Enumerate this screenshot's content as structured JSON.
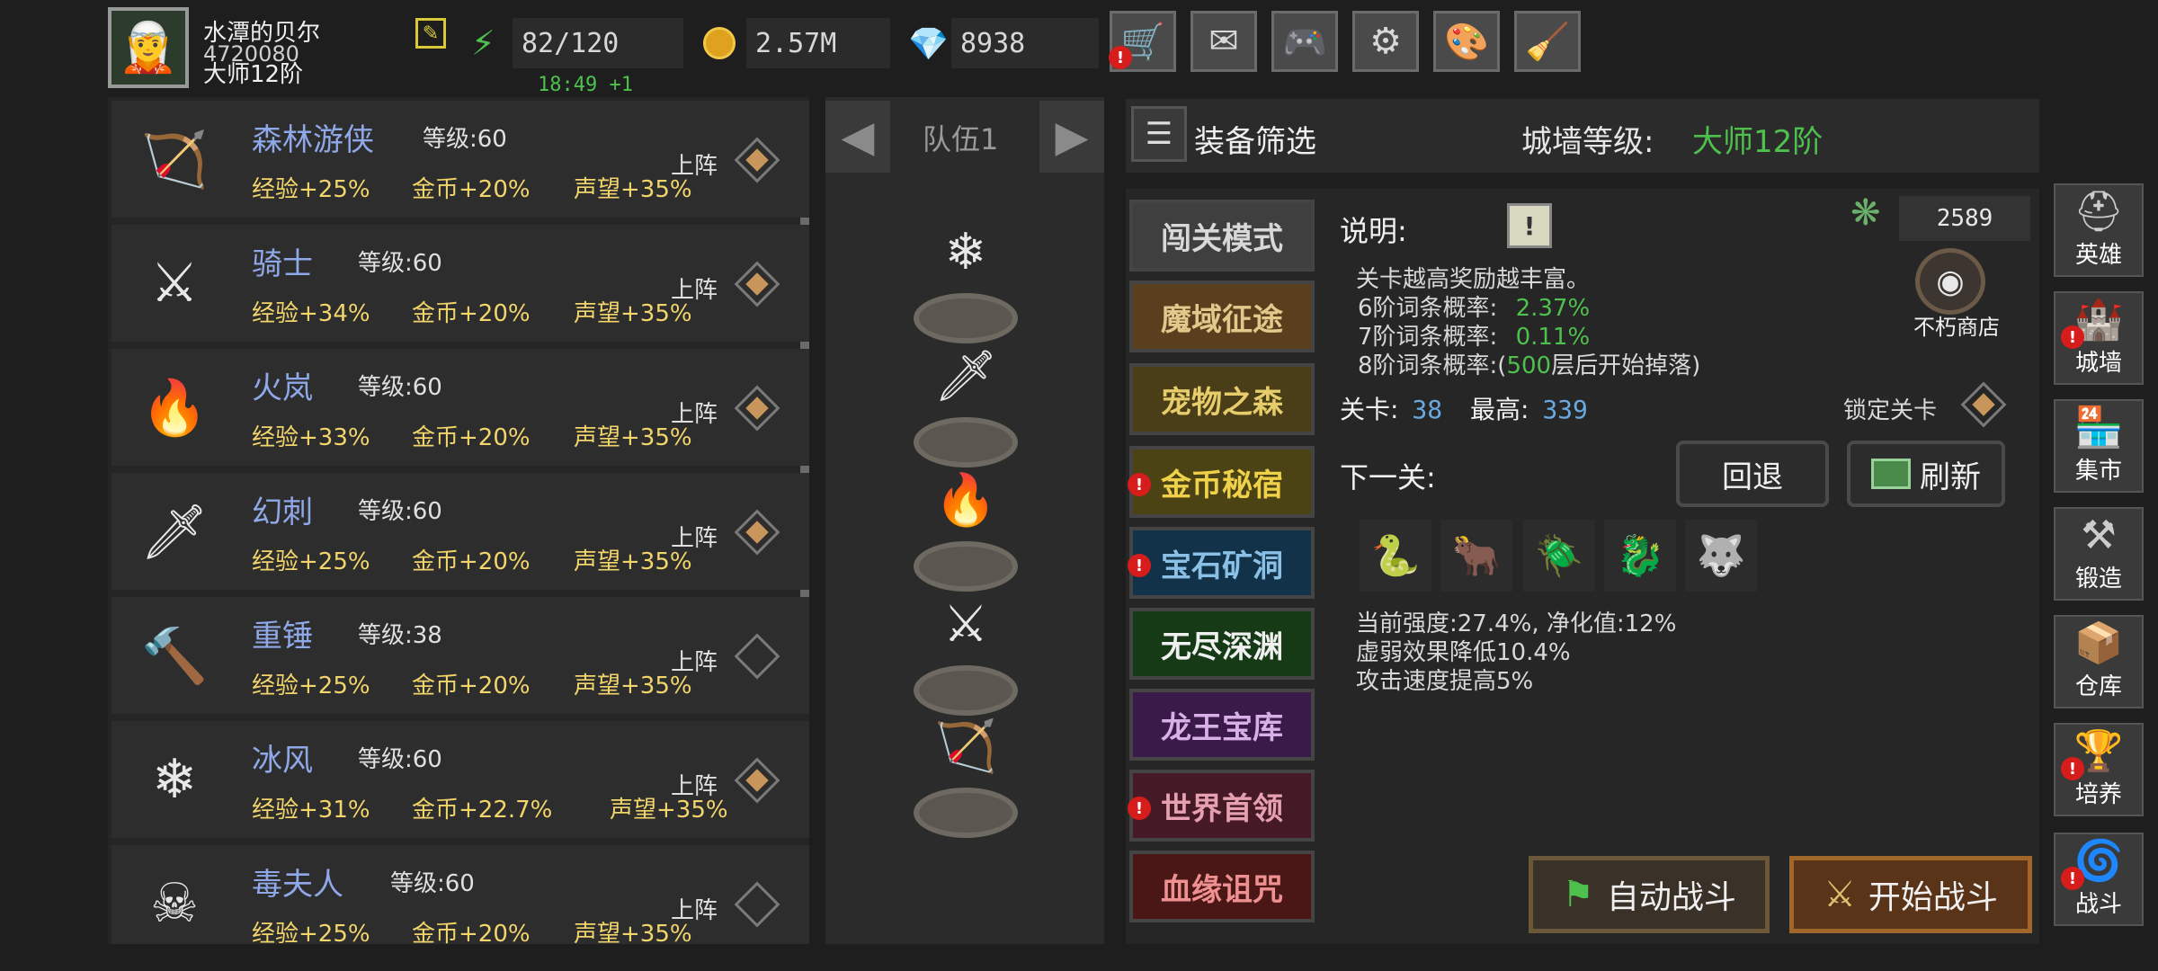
{
  "player": {
    "name": "水潭的贝尔",
    "id": "4720080",
    "rank": "大师12阶"
  },
  "stats": {
    "energy": "82/120",
    "energy_timer": "18:49 +1",
    "gold": "2.57M",
    "gems": "8938"
  },
  "top_icons": [
    "cart-icon",
    "mail-icon",
    "gamepad-icon",
    "gear-icon",
    "palette-icon",
    "broom-icon"
  ],
  "heroes": [
    {
      "name": "森林游侠",
      "level": "等级:60",
      "exp": "经验+25%",
      "gold": "金币+20%",
      "fame": "声望+35%",
      "deploy": "上阵",
      "active": true,
      "sprite": "🏹"
    },
    {
      "name": "骑士",
      "level": "等级:60",
      "exp": "经验+34%",
      "gold": "金币+20%",
      "fame": "声望+35%",
      "deploy": "上阵",
      "active": true,
      "sprite": "⚔"
    },
    {
      "name": "火岚",
      "level": "等级:60",
      "exp": "经验+33%",
      "gold": "金币+20%",
      "fame": "声望+35%",
      "deploy": "上阵",
      "active": true,
      "sprite": "🔥"
    },
    {
      "name": "幻刺",
      "level": "等级:60",
      "exp": "经验+25%",
      "gold": "金币+20%",
      "fame": "声望+35%",
      "deploy": "上阵",
      "active": true,
      "sprite": "🗡"
    },
    {
      "name": "重锤",
      "level": "等级:38",
      "exp": "经验+25%",
      "gold": "金币+20%",
      "fame": "声望+35%",
      "deploy": "上阵",
      "active": false,
      "sprite": "🔨"
    },
    {
      "name": "冰风",
      "level": "等级:60",
      "exp": "经验+31%",
      "gold": "金币+22.7%",
      "fame": "声望+35%",
      "deploy": "上阵",
      "active": true,
      "sprite": "❄"
    },
    {
      "name": "毒夫人",
      "level": "等级:60",
      "exp": "经验+25%",
      "gold": "金币+20%",
      "fame": "声望+35%",
      "deploy": "上阵",
      "active": false,
      "sprite": "☠"
    }
  ],
  "team": {
    "label": "队伍1",
    "members": [
      "❄",
      "🗡",
      "🔥",
      "⚔",
      "🏹"
    ]
  },
  "filter_label": "装备筛选",
  "wall": {
    "label": "城墙等级:",
    "value": "大师12阶"
  },
  "modes": [
    {
      "label": "闯关模式",
      "bg": "#3f3f3f",
      "fg": "#d8d8d8",
      "alert": false
    },
    {
      "label": "魔域征途",
      "bg": "#5a3f1f",
      "fg": "#e2c88a",
      "alert": false
    },
    {
      "label": "宠物之森",
      "bg": "#4a3e18",
      "fg": "#e6cc6a",
      "alert": false
    },
    {
      "label": "金币秘宿",
      "bg": "#4c4314",
      "fg": "#f0d24a",
      "alert": true
    },
    {
      "label": "宝石矿洞",
      "bg": "#12324a",
      "fg": "#8ac0e6",
      "alert": true
    },
    {
      "label": "无尽深渊",
      "bg": "#163a16",
      "fg": "#f0f0f0",
      "alert": false
    },
    {
      "label": "龙王宝库",
      "bg": "#3a1a48",
      "fg": "#d8b0e8",
      "alert": false
    },
    {
      "label": "世界首领",
      "bg": "#451a26",
      "fg": "#e6a0b0",
      "alert": true
    },
    {
      "label": "血缘诅咒",
      "bg": "#4a1616",
      "fg": "#ee9090",
      "alert": false
    }
  ],
  "info": {
    "title": "说明:",
    "line1": "关卡越高奖励越丰富。",
    "p6_label": "6阶词条概率:",
    "p6_value": "2.37%",
    "p7_label": "7阶词条概率:",
    "p7_value": "0.11%",
    "p8_label": "8阶词条概率:(",
    "p8_value": "500",
    "p8_suffix": "层后开始掉落)",
    "stage_label": "关卡:",
    "stage_value": "38",
    "best_label": "最高:",
    "best_value": "339",
    "lock_label": "锁定关卡",
    "next_label": "下一关:",
    "back_btn": "回退",
    "refresh_btn": "刷新",
    "strength": "当前强度:27.4%, 净化值:12%",
    "weaken": "虚弱效果降低10.4%",
    "atkspeed": "攻击速度提高5%"
  },
  "currency2": "2589",
  "immortal_shop": "不朽商店",
  "enemies": [
    "🐍",
    "🐂",
    "🪲",
    "🐉",
    "🐺"
  ],
  "auto_battle": "自动战斗",
  "start_battle": "开始战斗",
  "side_menu": [
    {
      "label": "英雄",
      "icon": "helmet-icon",
      "glyph": "⛑",
      "alert": false
    },
    {
      "label": "城墙",
      "icon": "castle-icon",
      "glyph": "🏰",
      "alert": true
    },
    {
      "label": "集市",
      "icon": "market-icon",
      "glyph": "🏪",
      "alert": false
    },
    {
      "label": "锻造",
      "icon": "anvil-icon",
      "glyph": "⚒",
      "alert": false
    },
    {
      "label": "仓库",
      "icon": "chest-icon",
      "glyph": "📦",
      "alert": false
    },
    {
      "label": "培养",
      "icon": "chalice-icon",
      "glyph": "🏆",
      "alert": true
    },
    {
      "label": "战斗",
      "icon": "portal-icon",
      "glyph": "🌀",
      "alert": true
    }
  ]
}
